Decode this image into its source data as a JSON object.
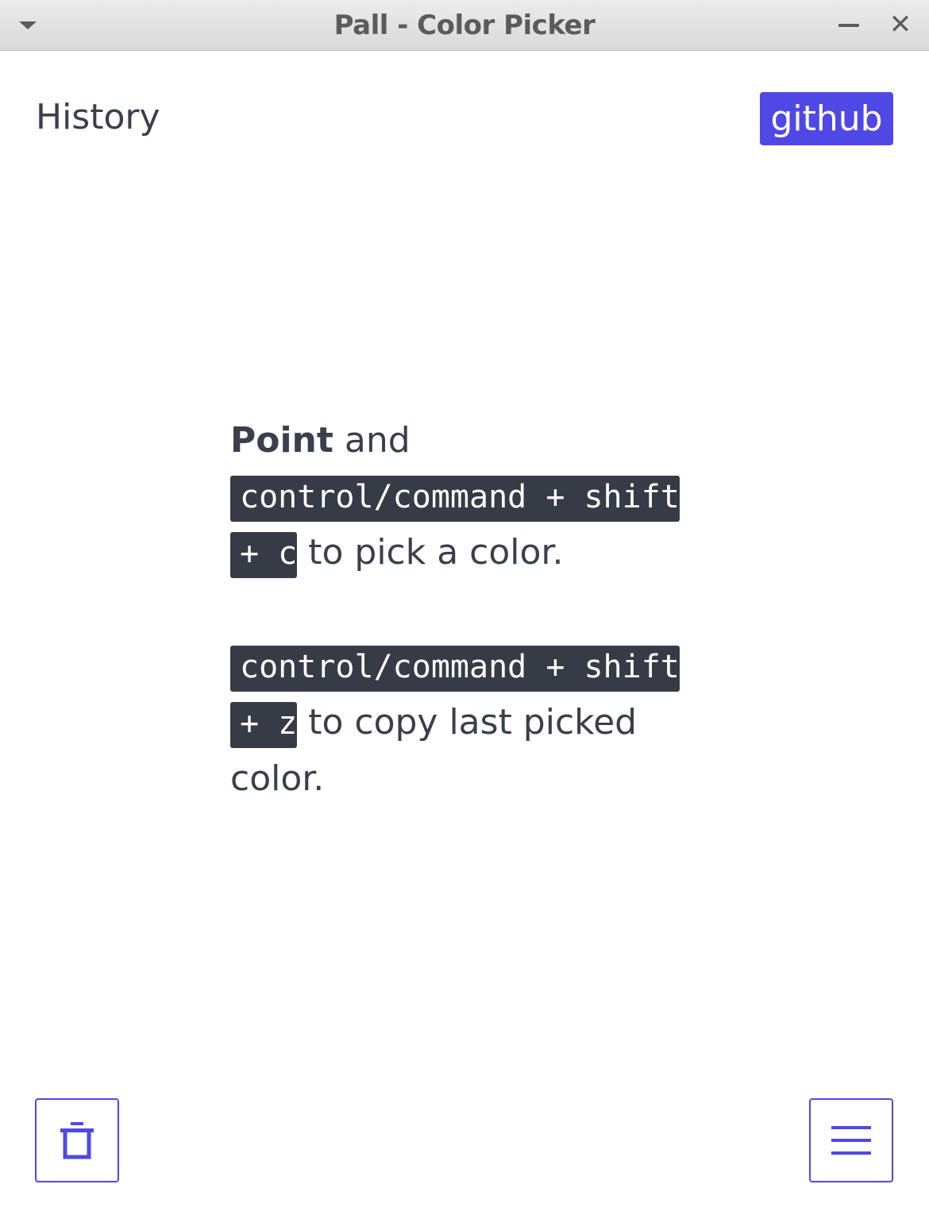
{
  "window": {
    "title": "Pall - Color Picker",
    "close_glyph": "✕",
    "icons": {
      "menu": "triangle-down-icon",
      "minimize": "minimize-icon",
      "close": "close-icon"
    }
  },
  "header": {
    "history_label": "History",
    "github_label": "github"
  },
  "instructions": {
    "line1_bold": "Point",
    "line1_rest": " and",
    "pick_shortcut": "control/command + shift + c",
    "pick_text": " to pick a color.",
    "copy_shortcut": "control/command + shift + z",
    "copy_text": " to copy last picked color."
  },
  "footer": {
    "icons": {
      "clear": "trash-icon",
      "menu": "hamburger-menu-icon"
    }
  },
  "colors": {
    "accent": "#5048e5",
    "text": "#3a3f4b",
    "code_bg": "#363b45",
    "titlebar": "#e0e0e0"
  }
}
